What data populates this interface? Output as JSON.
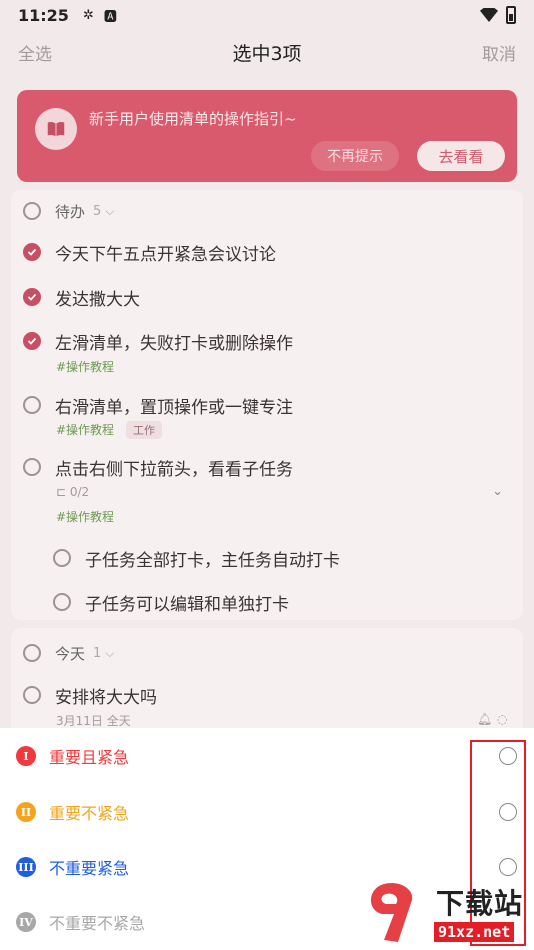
{
  "status_bar": {
    "time": "11:25"
  },
  "header": {
    "select_all": "全选",
    "title": "选中3项",
    "cancel": "取消"
  },
  "banner": {
    "text": "新手用户使用清单的操作指引~",
    "dismiss": "不再提示",
    "view": "去看看"
  },
  "group_todo": {
    "label": "待办",
    "count": "5"
  },
  "tasks": [
    {
      "title": "今天下午五点开紧急会议讨论",
      "checked": true
    },
    {
      "title": "发达撒大大",
      "checked": true
    },
    {
      "title": "左滑清单，失败打卡或删除操作",
      "checked": true,
      "tag": "#操作教程"
    },
    {
      "title": "右滑清单，置顶操作或一键专注",
      "checked": false,
      "tag": "#操作教程",
      "label": "工作"
    },
    {
      "title": "点击右侧下拉箭头，看看子任务",
      "checked": false,
      "subtask_count": "0/2",
      "tag": "#操作教程"
    }
  ],
  "subtasks": [
    {
      "title": "子任务全部打卡，主任务自动打卡"
    },
    {
      "title": "子任务可以编辑和单独打卡"
    }
  ],
  "group_today": {
    "label": "今天",
    "count": "1"
  },
  "today_task": {
    "title": "安排将大大吗",
    "date": "3月11日 全天"
  },
  "priorities": [
    {
      "numeral": "I",
      "label": "重要且紧急",
      "color": "#f03a3e"
    },
    {
      "numeral": "II",
      "label": "重要不紧急",
      "color": "#f2a51c"
    },
    {
      "numeral": "III",
      "label": "不重要紧急",
      "color": "#1f5fe0"
    },
    {
      "numeral": "IV",
      "label": "不重要不紧急",
      "color": "#a8a8a8"
    }
  ],
  "watermark": {
    "text": "下载站",
    "url": "91xz.net"
  }
}
